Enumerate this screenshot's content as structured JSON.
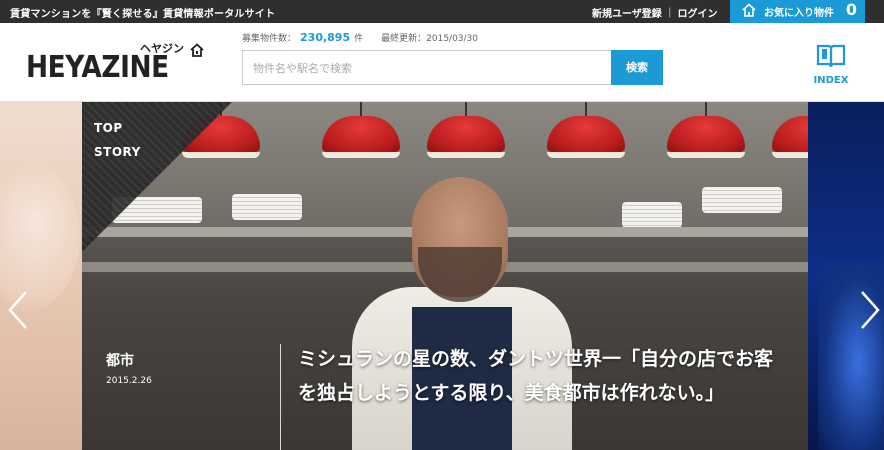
{
  "topbar": {
    "tagline": "賃貸マンションを『賢く探せる』賃貸情報ポータルサイト",
    "register": "新規ユーザ登録",
    "separator": "|",
    "login": "ログイン",
    "favorites_label": "お気に入り物件",
    "favorites_count": "0"
  },
  "header": {
    "logo": "HEYAZINE",
    "logo_kana": "ヘヤジン",
    "stats_label": "募集物件数：",
    "stats_count": "230,895",
    "stats_unit": "件",
    "updated_label": "最終更新：2015/03/30",
    "search_placeholder": "物件名や駅名で検索",
    "search_button": "検索",
    "index_label": "INDEX"
  },
  "hero": {
    "badge_line1": "TOP",
    "badge_line2": "STORY",
    "category": "都市",
    "date": "2015.2.26",
    "headline": "ミシュランの星の数、ダントツ世界一「自分の店でお客を独占しようとする限り、美食都市は作れない。」"
  },
  "icons": {
    "house": "house-icon",
    "book": "book-icon",
    "prev": "chevron-left-icon",
    "next": "chevron-right-icon"
  },
  "colors": {
    "accent": "#1b9ad6",
    "topbar": "#2f2f2f"
  }
}
